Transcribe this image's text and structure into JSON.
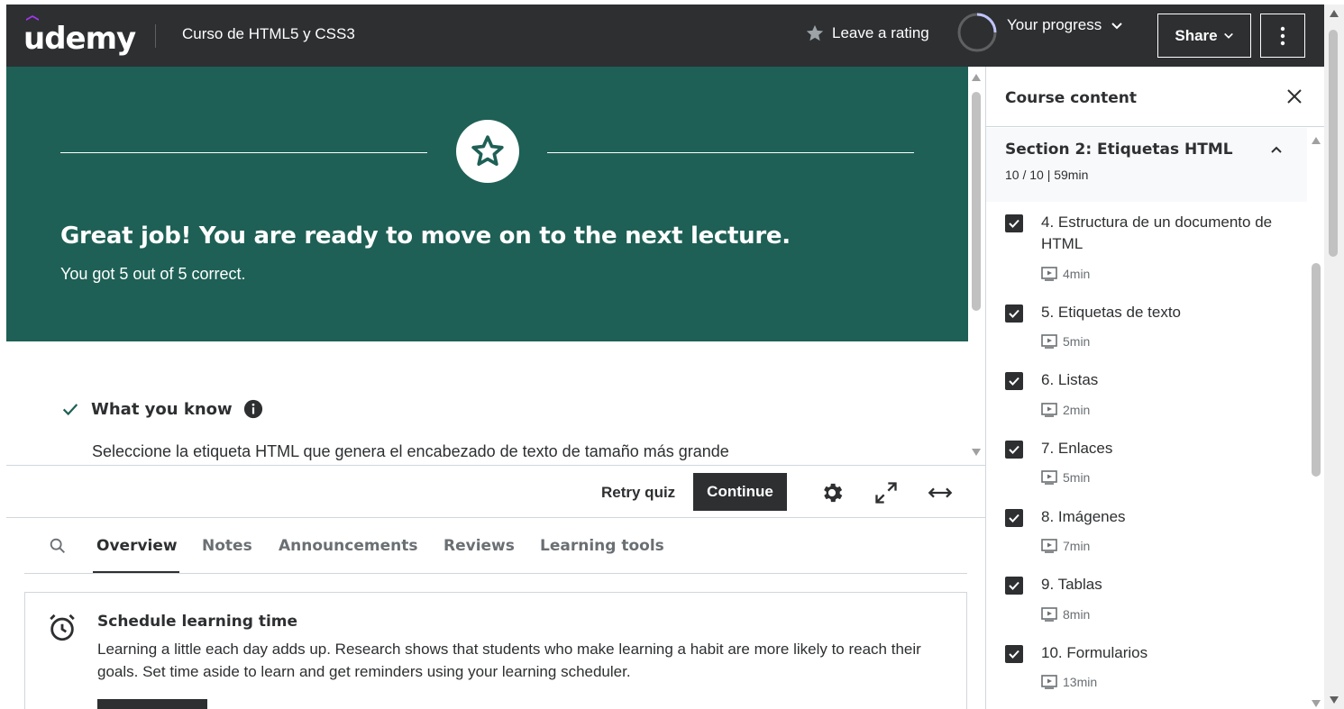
{
  "header": {
    "logo_text": "udemy",
    "course_title": "Curso de HTML5 y CSS3",
    "rating_label": "Leave a rating",
    "progress_label": "Your progress",
    "share_label": "Share"
  },
  "result": {
    "headline": "Great job! You are ready to move on to the next lecture.",
    "score_text": "You got 5 out of 5 correct."
  },
  "review": {
    "heading": "What you know",
    "question": "Seleccione la etiqueta HTML que genera el encabezado de texto de tamaño más grande"
  },
  "controls": {
    "retry_label": "Retry quiz",
    "continue_label": "Continue"
  },
  "tabs": [
    {
      "label": "Overview",
      "active": true
    },
    {
      "label": "Notes",
      "active": false
    },
    {
      "label": "Announcements",
      "active": false
    },
    {
      "label": "Reviews",
      "active": false
    },
    {
      "label": "Learning tools",
      "active": false
    }
  ],
  "schedule": {
    "title": "Schedule learning time",
    "body": "Learning a little each day adds up. Research shows that students who make learning a habit are more likely to reach their goals. Set time aside to learn and get reminders using your learning scheduler."
  },
  "sidebar": {
    "title": "Course content",
    "section": {
      "title": "Section 2: Etiquetas HTML",
      "meta": "10 / 10 | 59min"
    },
    "lectures": [
      {
        "title": "4. Estructura de un documento de HTML",
        "duration": "4min",
        "completed": true
      },
      {
        "title": "5. Etiquetas de texto",
        "duration": "5min",
        "completed": true
      },
      {
        "title": "6. Listas",
        "duration": "2min",
        "completed": true
      },
      {
        "title": "7. Enlaces",
        "duration": "5min",
        "completed": true
      },
      {
        "title": "8. Imágenes",
        "duration": "7min",
        "completed": true
      },
      {
        "title": "9. Tablas",
        "duration": "8min",
        "completed": true
      },
      {
        "title": "10. Formularios",
        "duration": "13min",
        "completed": true
      }
    ]
  },
  "colors": {
    "header_bg": "#2d2f31",
    "result_bg": "#1e6055",
    "brand_purple": "#a435f0",
    "check_green": "#1e6055"
  }
}
